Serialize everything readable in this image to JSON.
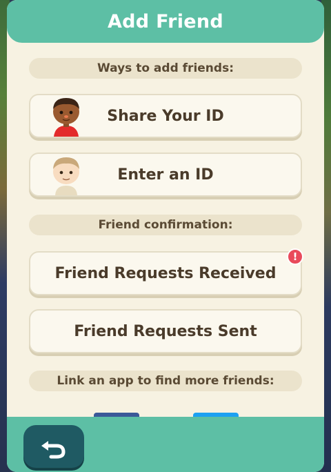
{
  "header": {
    "title": "Add Friend"
  },
  "sections": {
    "ways_label": "Ways to add friends:",
    "confirmation_label": "Friend confirmation:",
    "link_label": "Link an app to find more friends:"
  },
  "buttons": {
    "share_id": "Share Your ID",
    "enter_id": "Enter an ID",
    "requests_received": "Friend Requests Received",
    "requests_sent": "Friend Requests Sent"
  },
  "badges": {
    "received_alert": "!"
  },
  "colors": {
    "accent_teal": "#5dbfa5",
    "panel_cream": "#f7f2e2",
    "back_button": "#1f5a63",
    "alert_red": "#e94a5b",
    "facebook_blue": "#3b5998",
    "twitter_blue": "#1da1f2"
  },
  "icons": {
    "back": "back-arrow-icon",
    "avatar_share": "villager-avatar-red-shirt",
    "avatar_enter": "villager-avatar-plain"
  }
}
